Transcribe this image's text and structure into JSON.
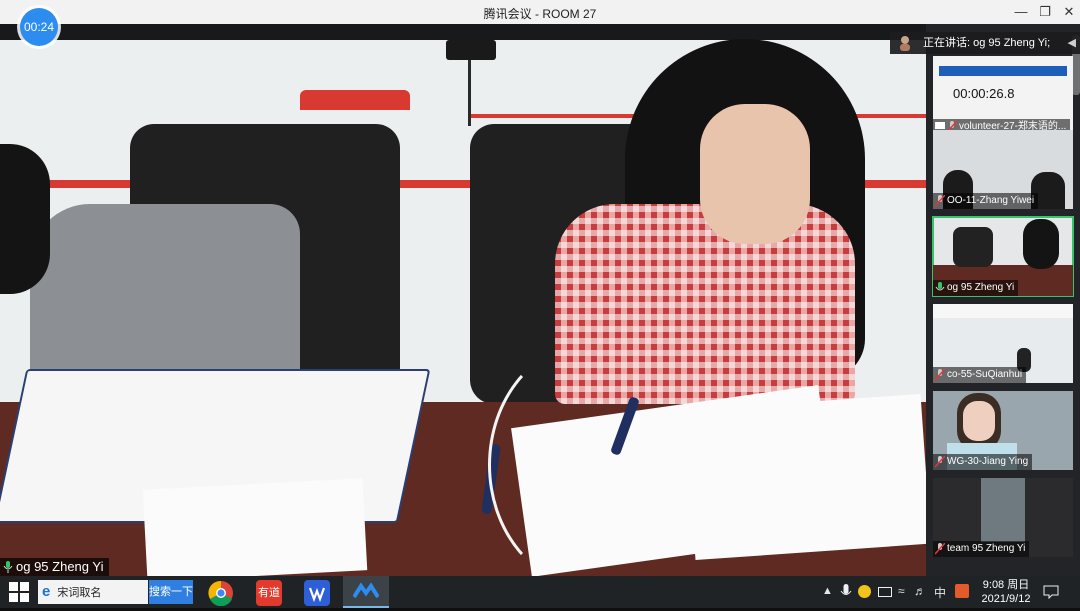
{
  "window": {
    "title": "腾讯会议 - ROOM 27",
    "timer": "00:24"
  },
  "stage": {
    "speaker_label": "og 95  Zheng Yi"
  },
  "sidebar": {
    "speaking_label": "正在讲话: og 95  Zheng Yi;",
    "thumbnails": [
      {
        "label": "volunteer-27-郑末语的...",
        "overlay_time": "00:00:26.8"
      },
      {
        "label": "OO-11-Zhang Yiwei"
      },
      {
        "label": "og 95  Zheng Yi"
      },
      {
        "label": "co-55-SuQianhui"
      },
      {
        "label": "WG-30-Jiang Ying"
      },
      {
        "label": "team 95 Zheng Yi"
      }
    ]
  },
  "taskbar": {
    "search_text": "宋词取名",
    "search_button": "搜索一下",
    "apps": [
      "ie-icon",
      "chrome-icon",
      "youdao-icon",
      "wps-icon",
      "tencent-meeting-icon"
    ],
    "youdao_label": "有道",
    "ime": "中",
    "clock": {
      "time": "9:08 周日",
      "date": "2021/9/12"
    }
  },
  "colors": {
    "accent_blue": "#2d8cf0",
    "active_border": "#34c56b",
    "titlebar": "#f2f2f2",
    "sidebar_bg": "#232427",
    "taskbar_bg": "#1f2326"
  }
}
